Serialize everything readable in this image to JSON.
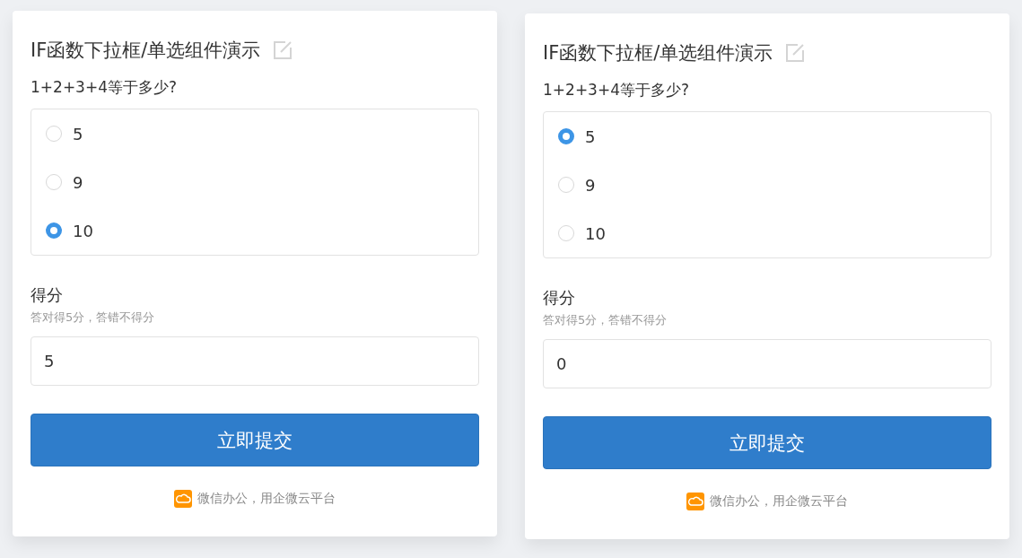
{
  "panels": [
    {
      "title": "IF函数下拉框/单选组件演示",
      "question": "1+2+3+4等于多少?",
      "options": [
        {
          "label": "5",
          "selected": false
        },
        {
          "label": "9",
          "selected": false
        },
        {
          "label": "10",
          "selected": true
        }
      ],
      "score_label": "得分",
      "score_hint": "答对得5分，答错不得分",
      "score_value": "5",
      "submit": "立即提交",
      "footer": "微信办公，用企微云平台"
    },
    {
      "title": "IF函数下拉框/单选组件演示",
      "question": "1+2+3+4等于多少?",
      "options": [
        {
          "label": "5",
          "selected": true
        },
        {
          "label": "9",
          "selected": false
        },
        {
          "label": "10",
          "selected": false
        }
      ],
      "score_label": "得分",
      "score_hint": "答对得5分，答错不得分",
      "score_value": "0",
      "submit": "立即提交",
      "footer": "微信办公，用企微云平台"
    }
  ]
}
